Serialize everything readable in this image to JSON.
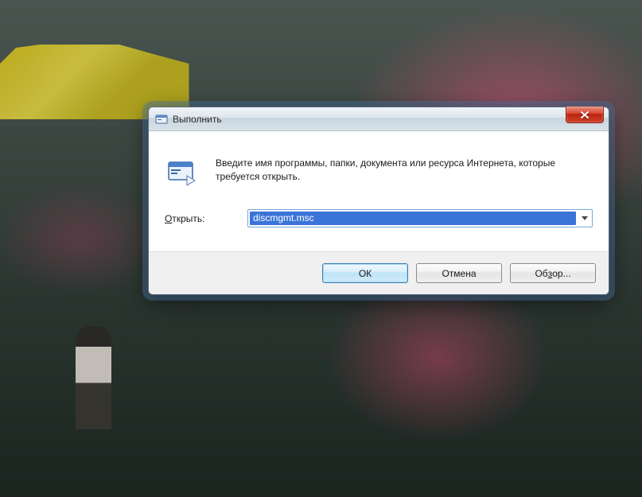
{
  "dialog": {
    "title": "Выполнить",
    "instruction": "Введите имя программы, папки, документа или ресурса Интернета, которые требуется открыть.",
    "open_label_prefix": "О",
    "open_label_rest": "ткрыть:",
    "input_value": "discmgmt.msc",
    "buttons": {
      "ok": "ОК",
      "cancel": "Отмена",
      "browse_prefix": "Об",
      "browse_ul": "з",
      "browse_rest": "ор..."
    }
  }
}
